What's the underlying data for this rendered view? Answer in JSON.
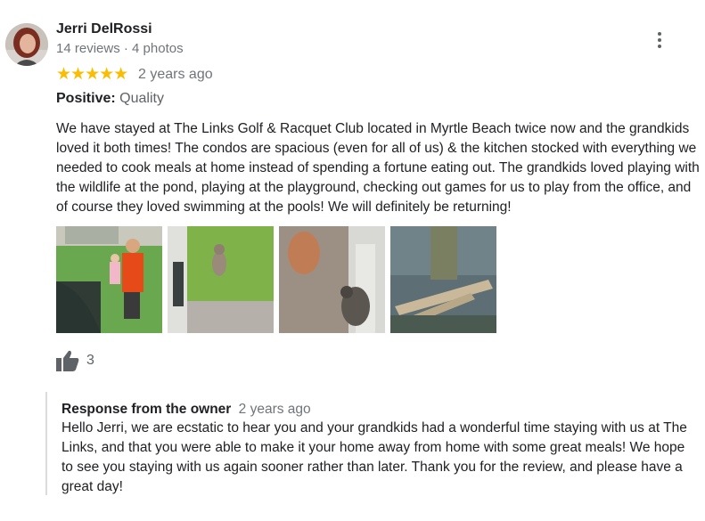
{
  "reviewer": {
    "name": "Jerri DelRossi",
    "meta": "14 reviews · 4 photos"
  },
  "rating": {
    "stars": 5,
    "star_glyphs": "★★★★★",
    "time_ago": "2 years ago"
  },
  "positive": {
    "label": "Positive:",
    "value": "Quality"
  },
  "review_text": "We have stayed at The Links Golf & Racquet Club located in Myrtle Beach twice now and the grandkids loved it both times! The condos are spacious (even for all of us) & the kitchen stocked with everything we needed to cook meals at home instead of spending a fortune eating out. The grandkids loved playing with the wildlife at the pond, playing at the playground, checking out games for us to play from the office, and of course they loved swimming at the pools! We will definitely be returning!",
  "photos": [
    {
      "name": "photo-kids-by-pond"
    },
    {
      "name": "photo-squirrel-on-grass"
    },
    {
      "name": "photo-squirrel-at-feeder"
    },
    {
      "name": "photo-pond-dock"
    }
  ],
  "likes": {
    "count": "3",
    "icon": "thumbs-up-icon"
  },
  "owner_response": {
    "title": "Response from the owner",
    "time_ago": "2 years ago",
    "text": "Hello Jerri, we are ecstatic to hear you and your grandkids had a wonderful time staying with us at The Links, and that you were able to make it your home away from home with some great meals! We hope to see you staying with us again sooner rather than later. Thank you for the review, and please have a great day!"
  },
  "colors": {
    "star": "#fbbc04",
    "muted_text": "#70757a",
    "divider": "#dadce0"
  }
}
